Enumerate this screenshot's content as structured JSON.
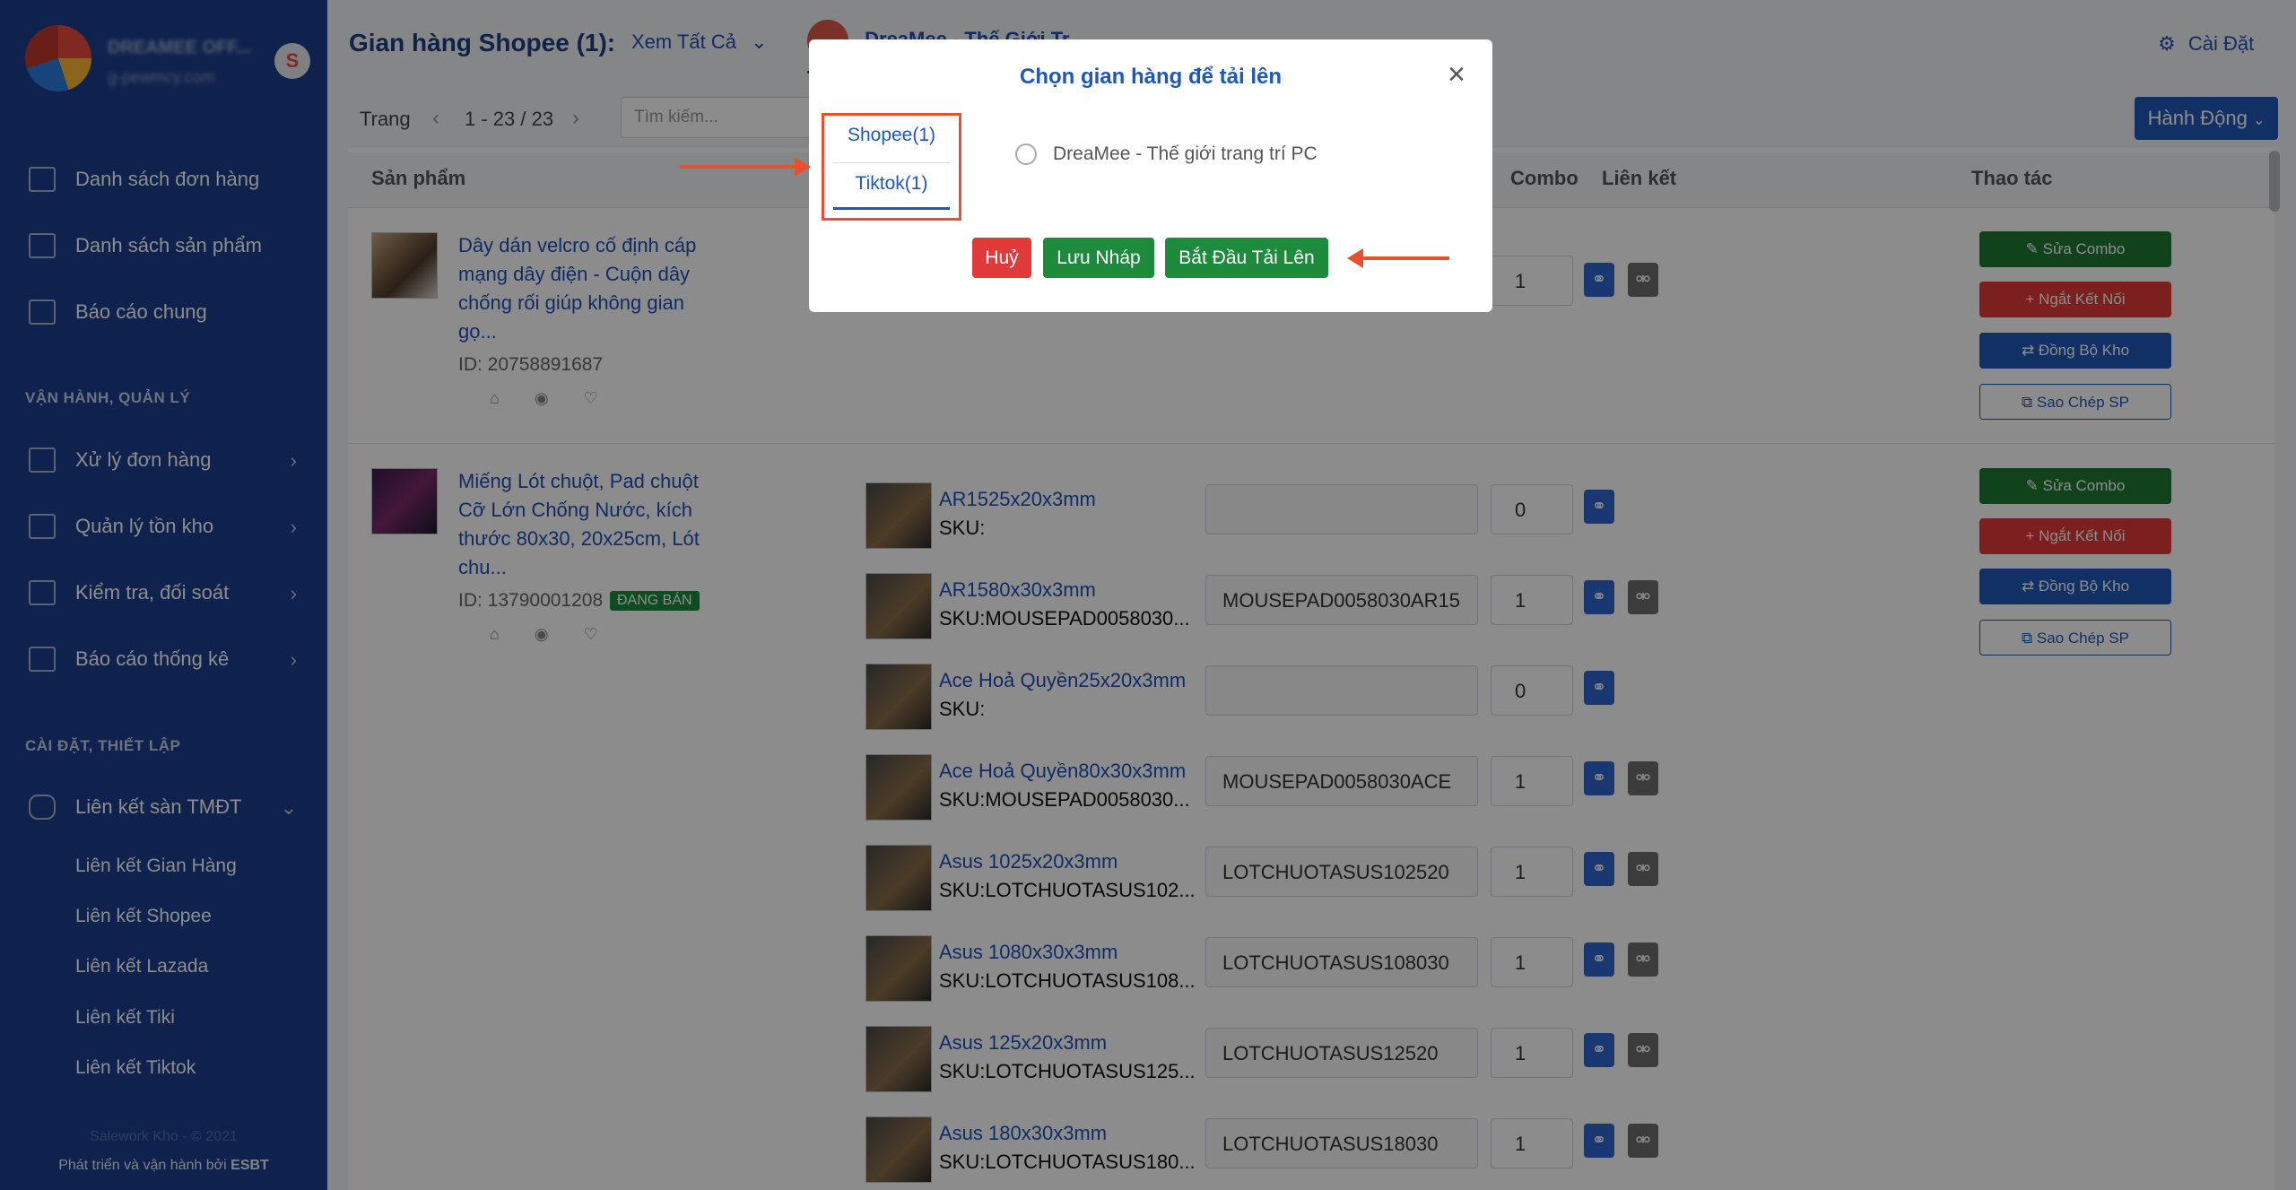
{
  "sidebar": {
    "brand_name": "DREAMEE OFF...",
    "brand_sub": "g-pewmcy.com",
    "menu": [
      {
        "label": "Danh sách đơn hàng"
      },
      {
        "label": "Danh sách sản phẩm"
      },
      {
        "label": "Báo cáo chung"
      }
    ],
    "section1": "VẬN HÀNH, QUẢN LÝ",
    "ops": [
      {
        "label": "Xử lý đơn hàng"
      },
      {
        "label": "Quản lý tồn kho"
      },
      {
        "label": "Kiểm tra, đối soát"
      },
      {
        "label": "Báo cáo thống kê"
      }
    ],
    "section2": "CÀI ĐẶT, THIẾT LẬP",
    "link_group": "Liên kết sàn TMĐT",
    "link_items": [
      "Liên kết Gian Hàng",
      "Liên kết Shopee",
      "Liên kết Lazada",
      "Liên kết Tiki",
      "Liên kết Tiktok"
    ],
    "copyright": "Salework Kho - © 2021",
    "footer_prefix": "Phát triển và vận hành bởi",
    "footer_brand": "ESBT"
  },
  "header": {
    "title": "Gian hàng Shopee (1):",
    "filter": "Xem Tất Cả",
    "shop_tab": "DreaMee - Thế Giới Tr...",
    "settings": "Cài Đặt"
  },
  "toolbar": {
    "page_label": "Trang",
    "page_range": "1 - 23 / 23",
    "search_placeholder": "Tìm kiếm...",
    "action_button": "Hành Động"
  },
  "table": {
    "headers": {
      "product": "Sản phẩm",
      "combo": "Combo",
      "link": "Liên kết",
      "ops": "Thao tác"
    },
    "products": [
      {
        "name_lines": [
          "Dây dán velcro cố định cáp",
          "mạng dây điện - Cuộn dây",
          "chống rối giúp không gian",
          "gọ..."
        ],
        "id": "ID: 20758891687",
        "badge": ""
      },
      {
        "name_lines": [
          "Miếng Lót chuột, Pad chuột",
          "Cỡ Lớn Chống Nước, kích",
          "thước 80x30, 20x25cm, Lót",
          "chu..."
        ],
        "id": "ID: 13790001208",
        "badge": "ĐANG BÁN"
      }
    ],
    "row1_qty": "1",
    "variants": [
      {
        "name": "AR1525x20x3mm",
        "sku": "SKU:",
        "code": "",
        "qty": "0",
        "unlink": false
      },
      {
        "name": "AR1580x30x3mm",
        "sku": "SKU:MOUSEPAD0058030...",
        "code": "MOUSEPAD0058030AR15",
        "qty": "1",
        "unlink": true
      },
      {
        "name": "Ace Hoả Quyền25x20x3mm",
        "sku": "SKU:",
        "code": "",
        "qty": "0",
        "unlink": false
      },
      {
        "name": "Ace Hoả Quyền80x30x3mm",
        "sku": "SKU:MOUSEPAD0058030...",
        "code": "MOUSEPAD0058030ACE",
        "qty": "1",
        "unlink": true
      },
      {
        "name": "Asus 1025x20x3mm",
        "sku": "SKU:LOTCHUOTASUS102...",
        "code": "LOTCHUOTASUS102520",
        "qty": "1",
        "unlink": true
      },
      {
        "name": "Asus 1080x30x3mm",
        "sku": "SKU:LOTCHUOTASUS108...",
        "code": "LOTCHUOTASUS108030",
        "qty": "1",
        "unlink": true
      },
      {
        "name": "Asus 125x20x3mm",
        "sku": "SKU:LOTCHUOTASUS125...",
        "code": "LOTCHUOTASUS12520",
        "qty": "1",
        "unlink": true
      },
      {
        "name": "Asus 180x30x3mm",
        "sku": "SKU:LOTCHUOTASUS180...",
        "code": "LOTCHUOTASUS18030",
        "qty": "1",
        "unlink": true
      }
    ],
    "actions": {
      "edit_combo": "Sửa Combo",
      "disconnect": "Ngắt Kết Nối",
      "sync_stock": "Đồng Bộ Kho",
      "copy_product": "Sao Chép SP"
    }
  },
  "modal": {
    "title": "Chọn gian hàng để tải lên",
    "tabs": [
      "Shopee(1)",
      "Tiktok(1)"
    ],
    "shop_option": "DreaMee - Thế giới trang trí PC",
    "cancel": "Huỷ",
    "save_draft": "Lưu Nháp",
    "start_upload": "Bắt Đầu Tải Lên"
  },
  "colors": {
    "sidebar": "#1d3f8f",
    "primary": "#2f66d0",
    "green": "#1e8a3c",
    "red": "#e03a3a",
    "annotation": "#e8502f"
  }
}
